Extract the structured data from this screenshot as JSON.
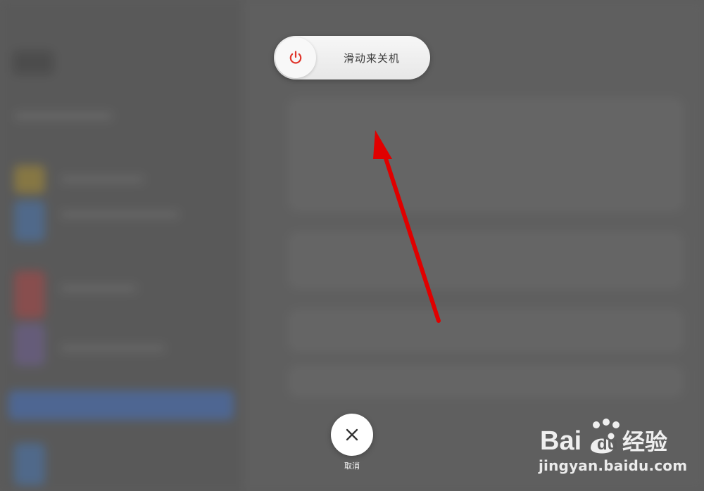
{
  "power_slider": {
    "label": "滑动来关机",
    "icon": "power-icon",
    "icon_color": "#e0352b"
  },
  "cancel": {
    "label": "取消",
    "icon": "close-icon"
  },
  "annotation": {
    "color": "#e00000"
  },
  "watermark": {
    "brand": "Bai du 经验",
    "url": "jingyan.baidu.com"
  }
}
